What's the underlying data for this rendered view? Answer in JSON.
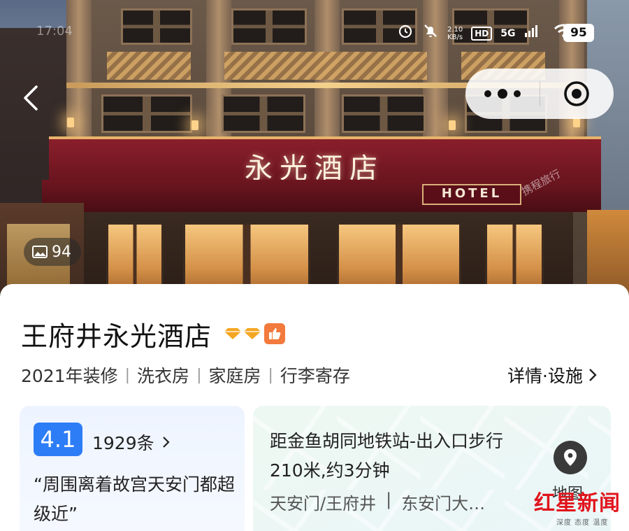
{
  "status_bar": {
    "time": "17:04",
    "net_speed_value": "2.10",
    "net_speed_unit": "KB/s",
    "hd_label": "HD",
    "network_label": "5G",
    "battery": "95"
  },
  "hero": {
    "sign_text": "永光酒店",
    "sign_subtext": "HOTEL",
    "watermark_text": "携程旅行",
    "photo_count": "94"
  },
  "hotel": {
    "name": "王府井永光酒店",
    "features": [
      "2021年装修",
      "洗衣房",
      "家庭房",
      "行李寄存"
    ],
    "details_link": "详情·设施"
  },
  "review": {
    "score": "4.1",
    "count": "1929条",
    "quote": "“周围离着故宫天安门都超级近”"
  },
  "location": {
    "distance": "距金鱼胡同地铁站-出入口步行210米,约3分钟",
    "areas": [
      "天安门/王府井",
      "|",
      "东安门大…"
    ],
    "map_label": "地图"
  },
  "watermark_logo": {
    "name": "红星新闻",
    "tagline": "深度 态度 温度"
  },
  "colors": {
    "score_blue": "#2d7df6",
    "badge_orange": "#f27a3c",
    "diamond_gold": "#f5a623",
    "logo_red": "#e1141c"
  },
  "icons": [
    "back-arrow-icon",
    "more-dots-icon",
    "close-target-icon",
    "image-icon",
    "diamond-icon",
    "thumbs-up-icon",
    "chevron-right-icon",
    "location-pin-icon",
    "mute-icon",
    "alarm-icon",
    "wifi-icon"
  ]
}
